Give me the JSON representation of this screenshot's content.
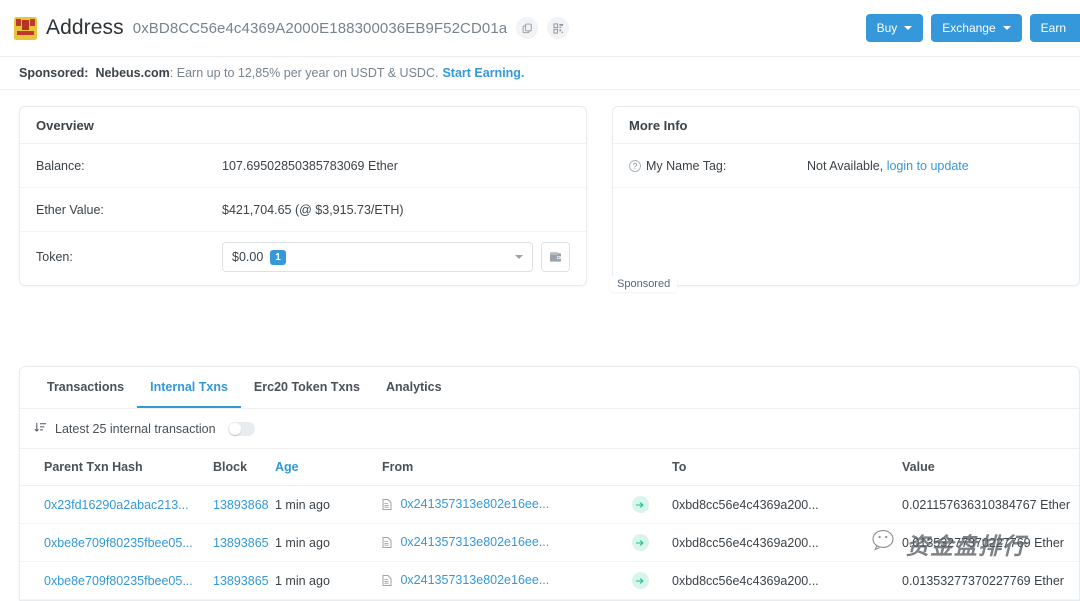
{
  "header": {
    "title": "Address",
    "address": "0xBD8CC56e4c4369A2000E188300036EB9F52CD01a",
    "copy_icon": "copy-icon",
    "qr_icon": "qr-code-icon",
    "buttons": {
      "buy": "Buy",
      "exchange": "Exchange",
      "earn": "Earn"
    }
  },
  "sponsor_bar": {
    "label": "Sponsored:",
    "domain": "Nebeus.com",
    "text": ": Earn up to 12,85% per year on USDT & USDC.",
    "cta": "Start Earning."
  },
  "overview": {
    "title": "Overview",
    "balance_label": "Balance:",
    "balance_value": "107.69502850385783069 Ether",
    "ether_value_label": "Ether Value:",
    "ether_value": "$421,704.65 (@ $3,915.73/ETH)",
    "token_label": "Token:",
    "token_value": "$0.00",
    "token_count": "1"
  },
  "more_info": {
    "title": "More Info",
    "name_tag_label": "My Name Tag:",
    "name_tag_value": "Not Available,",
    "name_tag_link": "login to update"
  },
  "sponsored_chip": "Sponsored",
  "tabs": [
    {
      "label": "Transactions",
      "active": false
    },
    {
      "label": "Internal Txns",
      "active": true
    },
    {
      "label": "Erc20 Token Txns",
      "active": false
    },
    {
      "label": "Analytics",
      "active": false
    }
  ],
  "filter": {
    "text": "Latest 25 internal transaction",
    "toggle_state": "off"
  },
  "table": {
    "columns": [
      "Parent Txn Hash",
      "Block",
      "Age",
      "From",
      "To",
      "Value"
    ],
    "sorted_column": "Age",
    "rows": [
      {
        "hash": "0x23fd16290a2abac213...",
        "block": "13893868",
        "age": "1 min ago",
        "from": "0x241357313e802e16ee...",
        "to": "0xbd8cc56e4c4369a200...",
        "value": "0.021157636310384767 Ether"
      },
      {
        "hash": "0xbe8e709f80235fbee05...",
        "block": "13893865",
        "age": "1 min ago",
        "from": "0x241357313e802e16ee...",
        "to": "0xbd8cc56e4c4369a200...",
        "value": "0.01353277370227769 Ether"
      },
      {
        "hash": "0xbe8e709f80235fbee05...",
        "block": "13893865",
        "age": "1 min ago",
        "from": "0x241357313e802e16ee...",
        "to": "0xbd8cc56e4c4369a200...",
        "value": "0.01353277370227769 Ether"
      }
    ]
  },
  "watermark": {
    "text": "资金盘排行",
    "icon": "wechat-icon"
  },
  "colors": {
    "accent_blue": "#3498db",
    "text_dark": "#3b4248",
    "text_muted": "#77838f",
    "border": "#e9ecef",
    "arrow_green": "#17c29a"
  }
}
